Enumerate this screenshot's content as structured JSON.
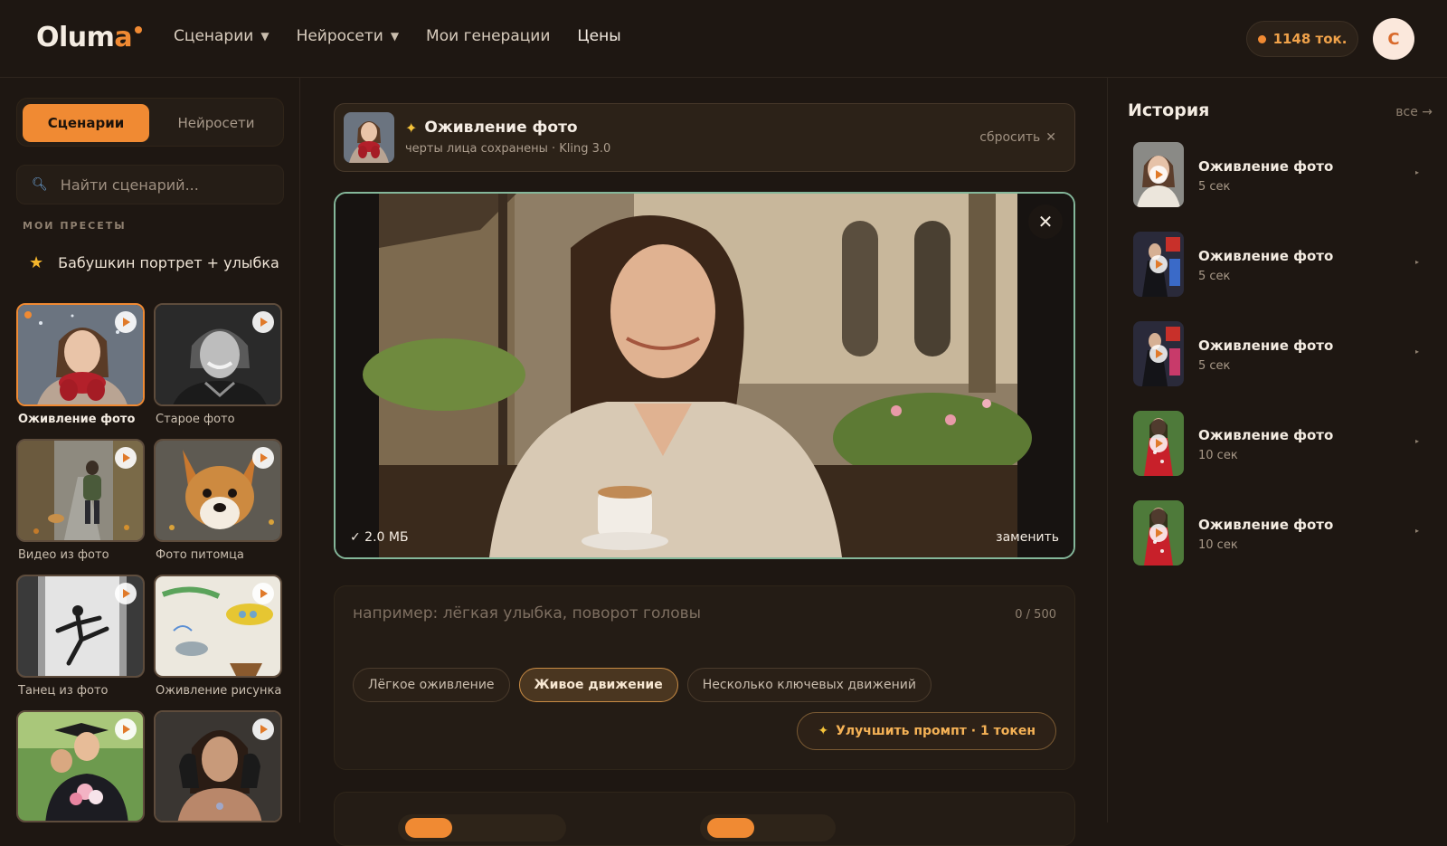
{
  "header": {
    "logo_main": "Olum",
    "logo_accent": "a",
    "nav": [
      {
        "label": "Сценарии",
        "has_caret": true
      },
      {
        "label": "Нейросети",
        "has_caret": true
      },
      {
        "label": "Мои генерации",
        "has_caret": false
      },
      {
        "label": "Цены",
        "has_caret": false
      }
    ],
    "tokens": "1148 ток.",
    "avatar_letter": "С",
    "accent_color": "#f08a33"
  },
  "sidebar": {
    "tab_active": "Сценарии",
    "tab_inactive": "Нейросети",
    "search_placeholder": "Найти сценарий...",
    "presets_heading": "МОИ ПРЕСЕТЫ",
    "preset_item": "Бабушкин портрет + улыбка",
    "tiles": [
      {
        "label": "Оживление фото",
        "active": true,
        "icon": "play-icon"
      },
      {
        "label": "Старое фото",
        "active": false,
        "icon": "play-icon"
      },
      {
        "label": "Видео из фото",
        "active": false,
        "icon": "play-icon"
      },
      {
        "label": "Фото питомца",
        "active": false,
        "icon": "play-icon"
      },
      {
        "label": "Танец из фото",
        "active": false,
        "icon": "play-icon"
      },
      {
        "label": "Оживление рисунка",
        "active": false,
        "icon": "play-icon"
      },
      {
        "label": "",
        "active": false,
        "icon": "play-icon"
      },
      {
        "label": "",
        "active": false,
        "icon": "play-icon"
      }
    ]
  },
  "main": {
    "scenario": {
      "title": "Оживление фото",
      "subtitle": "черты лица сохранены · Kling 3.0",
      "reset_label": "сбросить"
    },
    "preview": {
      "file_size": "✓ 2.0 МБ",
      "replace_label": "заменить"
    },
    "prompt": {
      "placeholder": "например: лёгкая улыбка, поворот головы",
      "counter": "0 / 500",
      "chips": [
        {
          "label": "Лёгкое оживление",
          "selected": false
        },
        {
          "label": "Живое движение",
          "selected": true
        },
        {
          "label": "Несколько ключевых движений",
          "selected": false
        }
      ],
      "improve_label": "Улучшить промпт · 1 токен"
    }
  },
  "history": {
    "title": "История",
    "all_label": "все →",
    "items": [
      {
        "name": "Оживление фото",
        "duration": "5 сек"
      },
      {
        "name": "Оживление фото",
        "duration": "5 сек"
      },
      {
        "name": "Оживление фото",
        "duration": "5 сек"
      },
      {
        "name": "Оживление фото",
        "duration": "10 сек"
      },
      {
        "name": "Оживление фото",
        "duration": "10 сек"
      }
    ]
  }
}
